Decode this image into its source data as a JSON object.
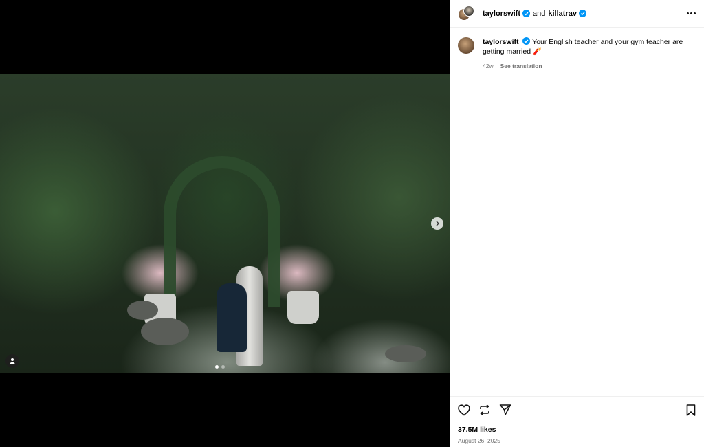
{
  "header": {
    "user1": "taylorswift",
    "joiner": "and",
    "user2": "killatrav"
  },
  "caption": {
    "username": "taylorswift",
    "text": "Your English teacher and your gym teacher are getting married",
    "emoji": "🧨",
    "age": "42w",
    "translate": "See translation"
  },
  "icons": {
    "like": "heart-icon",
    "repost": "repost-icon",
    "share": "send-icon",
    "save": "bookmark-icon",
    "tag": "user-tag-icon",
    "next": "chevron-right-icon",
    "more": "more-icon"
  },
  "carousel": {
    "current": 1,
    "total": 2
  },
  "stats": {
    "likes": "37.5M likes",
    "date": "August 26, 2025"
  },
  "colors": {
    "verified": "#0095f6",
    "muted": "#737373"
  }
}
